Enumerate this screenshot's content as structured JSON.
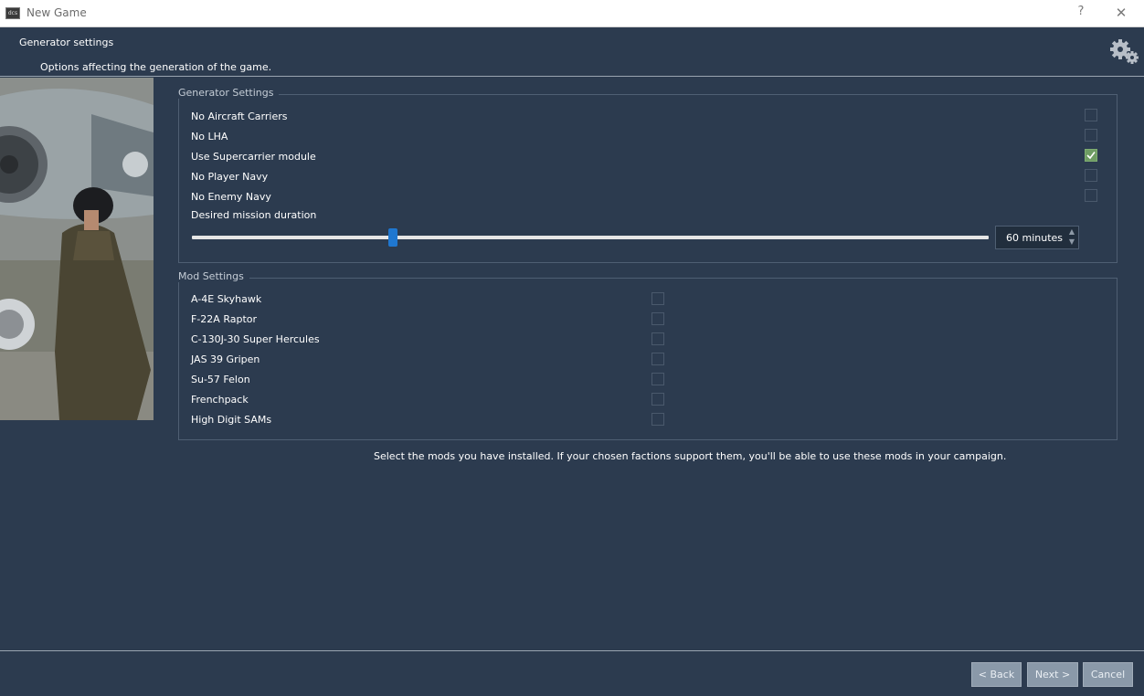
{
  "window": {
    "title": "New Game",
    "app_icon_text": "dcs",
    "help_glyph": "?",
    "close_glyph": "✕"
  },
  "page": {
    "title": "Generator settings",
    "subtitle": "Options affecting the generation of the game.",
    "icon": "gear-icon"
  },
  "generator_settings": {
    "title": "Generator Settings",
    "options": [
      {
        "label": "No Aircraft Carriers",
        "checked": false
      },
      {
        "label": "No LHA",
        "checked": false
      },
      {
        "label": "Use Supercarrier module",
        "checked": true
      },
      {
        "label": "No Player Navy",
        "checked": false
      },
      {
        "label": "No Enemy Navy",
        "checked": false
      }
    ],
    "duration_label": "Desired mission duration",
    "duration_value": "60 minutes"
  },
  "mod_settings": {
    "title": "Mod Settings",
    "mods": [
      {
        "label": "A-4E Skyhawk",
        "checked": false
      },
      {
        "label": "F-22A Raptor",
        "checked": false
      },
      {
        "label": "C-130J-30 Super Hercules",
        "checked": false
      },
      {
        "label": "JAS 39 Gripen",
        "checked": false
      },
      {
        "label": "Su-57 Felon",
        "checked": false
      },
      {
        "label": "Frenchpack",
        "checked": false
      },
      {
        "label": "High Digit SAMs",
        "checked": false
      }
    ]
  },
  "info_text": "Select the mods you have installed. If your chosen factions support them, you'll be able to use these mods in your campaign.",
  "buttons": {
    "back": "< Back",
    "next": "Next >",
    "cancel": "Cancel"
  },
  "colors": {
    "background": "#2c3b4f",
    "check_accent": "#6e9c63",
    "slider_handle": "#1f77d0",
    "button": "#8a99a9"
  }
}
